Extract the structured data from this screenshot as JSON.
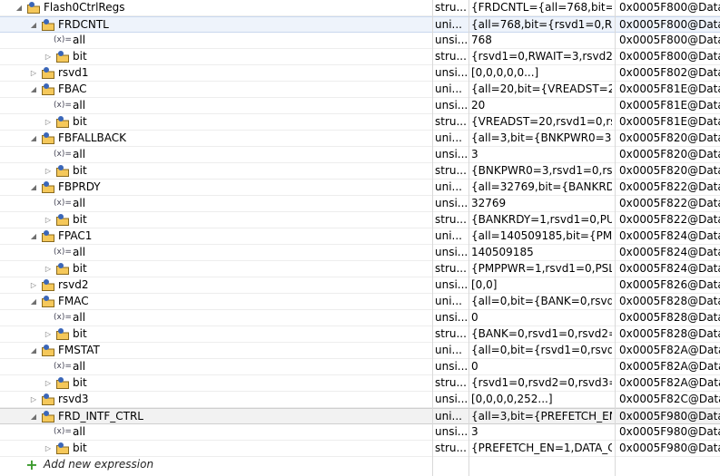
{
  "rows": [
    {
      "level": 0,
      "expander": "open",
      "icon": "struct",
      "name": "Flash0CtrlRegs",
      "type": "stru...",
      "value": "{FRDCNTL={all=768,bit={rs...",
      "location": "0x0005F800@Data"
    },
    {
      "level": 1,
      "expander": "open",
      "icon": "struct",
      "name": "FRDCNTL",
      "type": "uni...",
      "value": "{all=768,bit={rsvd1=0,RWAI...",
      "location": "0x0005F800@Data",
      "selected": true
    },
    {
      "level": 2,
      "expander": "none",
      "icon": "var",
      "name": "all",
      "type": "unsi...",
      "value": "768",
      "location": "0x0005F800@Data"
    },
    {
      "level": 2,
      "expander": "closed",
      "icon": "struct",
      "name": "bit",
      "type": "stru...",
      "value": "{rsvd1=0,RWAIT=3,rsvd2=0...",
      "location": "0x0005F800@Data"
    },
    {
      "level": 1,
      "expander": "closed",
      "icon": "struct",
      "name": "rsvd1",
      "type": "unsi...",
      "value": "[0,0,0,0,0...]",
      "location": "0x0005F802@Data"
    },
    {
      "level": 1,
      "expander": "open",
      "icon": "struct",
      "name": "FBAC",
      "type": "uni...",
      "value": "{all=20,bit={VREADST=20,r...",
      "location": "0x0005F81E@Data"
    },
    {
      "level": 2,
      "expander": "none",
      "icon": "var",
      "name": "all",
      "type": "unsi...",
      "value": "20",
      "location": "0x0005F81E@Data"
    },
    {
      "level": 2,
      "expander": "closed",
      "icon": "struct",
      "name": "bit",
      "type": "stru...",
      "value": "{VREADST=20,rsvd1=0,rsvd...",
      "location": "0x0005F81E@Data"
    },
    {
      "level": 1,
      "expander": "open",
      "icon": "struct",
      "name": "FBFALLBACK",
      "type": "uni...",
      "value": "{all=3,bit={BNKPWR0=3,rsv...",
      "location": "0x0005F820@Data"
    },
    {
      "level": 2,
      "expander": "none",
      "icon": "var",
      "name": "all",
      "type": "unsi...",
      "value": "3",
      "location": "0x0005F820@Data"
    },
    {
      "level": 2,
      "expander": "closed",
      "icon": "struct",
      "name": "bit",
      "type": "stru...",
      "value": "{BNKPWR0=3,rsvd1=0,rsvd...",
      "location": "0x0005F820@Data"
    },
    {
      "level": 1,
      "expander": "open",
      "icon": "struct",
      "name": "FBPRDY",
      "type": "uni...",
      "value": "{all=32769,bit={BANKRDY=...",
      "location": "0x0005F822@Data"
    },
    {
      "level": 2,
      "expander": "none",
      "icon": "var",
      "name": "all",
      "type": "unsi...",
      "value": "32769",
      "location": "0x0005F822@Data"
    },
    {
      "level": 2,
      "expander": "closed",
      "icon": "struct",
      "name": "bit",
      "type": "stru...",
      "value": "{BANKRDY=1,rsvd1=0,PUM...",
      "location": "0x0005F822@Data"
    },
    {
      "level": 1,
      "expander": "open",
      "icon": "struct",
      "name": "FPAC1",
      "type": "uni...",
      "value": "{all=140509185,bit={PMPP...",
      "location": "0x0005F824@Data"
    },
    {
      "level": 2,
      "expander": "none",
      "icon": "var",
      "name": "all",
      "type": "unsi...",
      "value": "140509185",
      "location": "0x0005F824@Data"
    },
    {
      "level": 2,
      "expander": "closed",
      "icon": "struct",
      "name": "bit",
      "type": "stru...",
      "value": "{PMPPWR=1,rsvd1=0,PSLE...",
      "location": "0x0005F824@Data"
    },
    {
      "level": 1,
      "expander": "closed",
      "icon": "struct",
      "name": "rsvd2",
      "type": "unsi...",
      "value": "[0,0]",
      "location": "0x0005F826@Data"
    },
    {
      "level": 1,
      "expander": "open",
      "icon": "struct",
      "name": "FMAC",
      "type": "uni...",
      "value": "{all=0,bit={BANK=0,rsvd1=...",
      "location": "0x0005F828@Data"
    },
    {
      "level": 2,
      "expander": "none",
      "icon": "var",
      "name": "all",
      "type": "unsi...",
      "value": "0",
      "location": "0x0005F828@Data"
    },
    {
      "level": 2,
      "expander": "closed",
      "icon": "struct",
      "name": "bit",
      "type": "stru...",
      "value": "{BANK=0,rsvd1=0,rsvd2=0}",
      "location": "0x0005F828@Data"
    },
    {
      "level": 1,
      "expander": "open",
      "icon": "struct",
      "name": "FMSTAT",
      "type": "uni...",
      "value": "{all=0,bit={rsvd1=0,rsvd2=...",
      "location": "0x0005F82A@Data"
    },
    {
      "level": 2,
      "expander": "none",
      "icon": "var",
      "name": "all",
      "type": "unsi...",
      "value": "0",
      "location": "0x0005F82A@Data"
    },
    {
      "level": 2,
      "expander": "closed",
      "icon": "struct",
      "name": "bit",
      "type": "stru...",
      "value": "{rsvd1=0,rsvd2=0,rsvd3=0,...",
      "location": "0x0005F82A@Data"
    },
    {
      "level": 1,
      "expander": "closed",
      "icon": "struct",
      "name": "rsvd3",
      "type": "unsi...",
      "value": "[0,0,0,0,252...]",
      "location": "0x0005F82C@Data"
    },
    {
      "level": 1,
      "expander": "open",
      "icon": "struct",
      "name": "FRD_INTF_CTRL",
      "type": "uni...",
      "value": "{all=3,bit={PREFETCH_EN=...",
      "location": "0x0005F980@Data",
      "highlight": true
    },
    {
      "level": 2,
      "expander": "none",
      "icon": "var",
      "name": "all",
      "type": "unsi...",
      "value": "3",
      "location": "0x0005F980@Data"
    },
    {
      "level": 2,
      "expander": "closed",
      "icon": "struct",
      "name": "bit",
      "type": "stru...",
      "value": "{PREFETCH_EN=1,DATA_C...",
      "location": "0x0005F980@Data"
    }
  ],
  "add_expression": {
    "label": "Add new expression",
    "icon": "plus-icon"
  },
  "colors": {
    "struct_icon_fill": "#f5c85a",
    "struct_icon_border": "#8a6a1e",
    "struct_icon_badge": "#3a66b8",
    "plus_icon": "#3c9a2e",
    "grid_line": "#d9d9d9",
    "selected_bg": "#eef3fb"
  }
}
